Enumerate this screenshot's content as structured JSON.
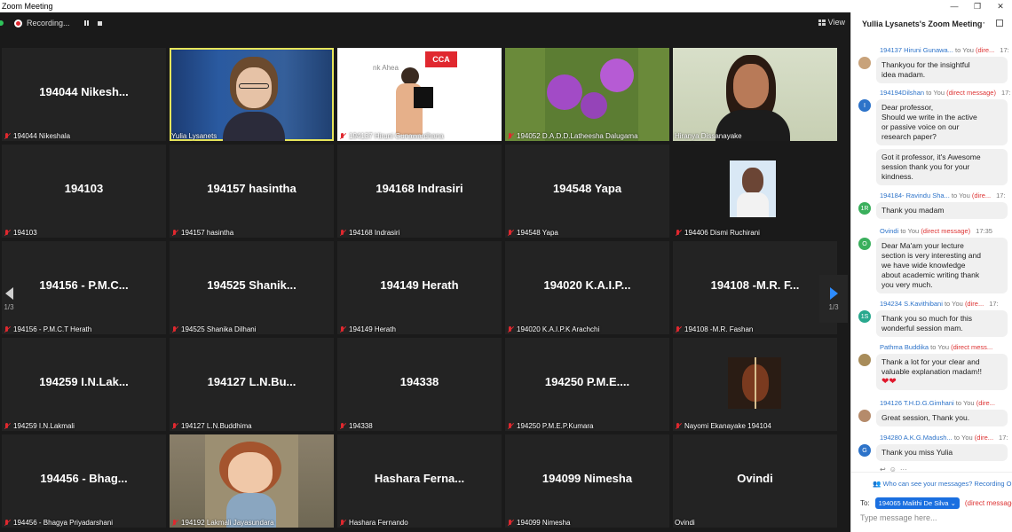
{
  "window": {
    "title": "Zoom Meeting",
    "minimize": "—",
    "maximize": "❐",
    "close": "✕"
  },
  "topbar": {
    "recording_label": "Recording...",
    "view_label": "View"
  },
  "pager": {
    "left": "1/3",
    "right": "1/3"
  },
  "tiles": [
    {
      "big": "194044   Nikesh...",
      "caption": "194044  Nikeshala",
      "muted": true
    },
    {
      "big": "",
      "caption": "Yulia Lysanets",
      "muted": false,
      "active": true,
      "video": "yulia"
    },
    {
      "big": "",
      "caption": "194137 Hiruni Gunawardhana",
      "muted": true,
      "video": "hiruni"
    },
    {
      "big": "",
      "caption": "194052 D.A.D.D.Latheesha Dalugama",
      "muted": true,
      "video": "flower"
    },
    {
      "big": "",
      "caption": "Hiranya Dissanayake",
      "muted": false,
      "video": "hiranya"
    },
    {
      "big": "194103",
      "caption": "194103",
      "muted": true
    },
    {
      "big": "194157 hasintha",
      "caption": "194157 hasintha",
      "muted": true
    },
    {
      "big": "194168 Indrasiri",
      "caption": "194168 Indrasiri",
      "muted": true
    },
    {
      "big": "194548 Yapa",
      "caption": "194548 Yapa",
      "muted": true
    },
    {
      "big": "",
      "caption": "194406 Dismi Ruchirani",
      "muted": true,
      "video": "dismi"
    },
    {
      "big": "194156 - P.M.C...",
      "caption": "194156 - P.M.C.T Herath",
      "muted": true
    },
    {
      "big": "194525  Shanik...",
      "caption": "194525 Shanika Dilhani",
      "muted": true
    },
    {
      "big": "194149 Herath",
      "caption": "194149 Herath",
      "muted": true
    },
    {
      "big": "194020  K.A.I.P...",
      "caption": "194020 K.A.I.P.K Arachchi",
      "muted": true
    },
    {
      "big": "194108 -M.R. F...",
      "caption": "194108 -M.R. Fashan",
      "muted": true
    },
    {
      "big": "194259  I.N.Lak...",
      "caption": "194259 I.N.Lakmali",
      "muted": true
    },
    {
      "big": "194127  L.N.Bu...",
      "caption": "194127 L.N.Buddhima",
      "muted": true
    },
    {
      "big": "194338",
      "caption": "194338",
      "muted": true
    },
    {
      "big": "194250  P.M.E....",
      "caption": "194250 P.M.E.P.Kumara",
      "muted": true
    },
    {
      "big": "",
      "caption": "Nayomi Ekanayake 194104",
      "muted": true,
      "video": "cello"
    },
    {
      "big": "194456  -  Bhag...",
      "caption": "194456 - Bhagya Priyadarshani",
      "muted": true
    },
    {
      "big": "",
      "caption": "194192 Lakmali Jayasundara",
      "muted": true,
      "video": "lakmali"
    },
    {
      "big": "Hashara  Ferna...",
      "caption": "Hashara Fernando",
      "muted": true
    },
    {
      "big": "194099 Nimesha",
      "caption": "194099 Nimesha",
      "muted": true
    },
    {
      "big": "Ovindi",
      "caption": "Ovindi",
      "muted": false
    }
  ],
  "chat": {
    "header": "Yullia Lysanets's Zoom Meeting",
    "more": "···",
    "messages": [
      {
        "sender": "194137 Hiruni Gunawa...",
        "to": " to You",
        "dm": "(dire...",
        "time": "17:",
        "avatar": "",
        "avatar_color": "#c8a27a",
        "text": [
          "Thankyou for the insightful",
          "idea madam."
        ]
      },
      {
        "sender": "194194Dilshan",
        "to": " to You",
        "dm": "(direct message)",
        "time": "17:",
        "avatar": "I",
        "avatar_color": "#2d73c9",
        "text": [
          "Dear professor,",
          "Should we write in the active",
          "or passive voice on our",
          "research paper?"
        ]
      },
      {
        "sender": "",
        "to": "",
        "dm": "",
        "time": "",
        "avatar": "",
        "avatar_color": "",
        "text": [
          "Got it professor, it's Awesome",
          "session thank you for your",
          "kindness."
        ]
      },
      {
        "sender": "194184- Ravindu Sha...",
        "to": " to You",
        "dm": "(dire...",
        "time": "17:",
        "avatar": "1R",
        "avatar_color": "#3aaf5c",
        "text": [
          "Thank you madam"
        ]
      },
      {
        "sender": "Ovindi",
        "to": " to You",
        "dm": "(direct message)",
        "time": "17:35",
        "avatar": "O",
        "avatar_color": "#3aaf5c",
        "text": [
          "Dear Ma'am your lecture",
          "section is very interesting and",
          "we have wide knowledge",
          "about academic writing thank",
          "you very much."
        ]
      },
      {
        "sender": "194234 S.Kavithibani",
        "to": " to You",
        "dm": "(dire...",
        "time": "17:",
        "avatar": "1S",
        "avatar_color": "#29a88e",
        "text": [
          "Thank you so much for this",
          "wonderful session mam."
        ]
      },
      {
        "sender": "Pathma Buddika",
        "to": " to You",
        "dm": "(direct mess...",
        "time": "",
        "avatar": "",
        "avatar_color": "#a88c5a",
        "text": [
          "Thank a lot for your clear and",
          "valuable explanation  madam!!",
          "❤❤"
        ]
      },
      {
        "sender": "194126 T.H.D.G.Gimhani",
        "to": " to You",
        "dm": "(dire...",
        "time": "",
        "avatar": "",
        "avatar_color": "#b58b6b",
        "text": [
          "Great session, Thank you."
        ]
      },
      {
        "sender": "194280  A.K.G.Madush...",
        "to": " to You",
        "dm": "(dire...",
        "time": "17:",
        "avatar": "G",
        "avatar_color": "#2d73c9",
        "text": [
          "Thank you miss Yulia"
        ]
      }
    ],
    "who_can_see": "Who can see your messages? Recording On",
    "to_label": "To:",
    "to_recipient": "194065 Malithi De Silva",
    "to_dm": "(direct message)",
    "input_placeholder": "Type message here..."
  }
}
